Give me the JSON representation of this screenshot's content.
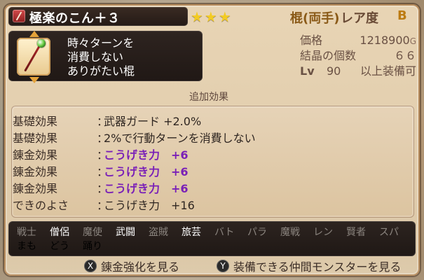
{
  "header": {
    "title": "極楽のこん＋３",
    "stars": "★★★",
    "weapon_type": "棍(両手)",
    "rarity_label": "レア度",
    "rarity_value": "B",
    "title_icon": "staff-item-icon"
  },
  "description": {
    "lines": [
      "時々ターンを",
      "消費しない",
      "ありがたい棍"
    ],
    "thumbnail_icon": "staff-thumbnail-icon"
  },
  "stats": {
    "price_label": "価格",
    "price_value": "1218900",
    "currency": "G",
    "crystal_label": "結晶の個数",
    "crystal_value": "６６",
    "lv_label": "Lv",
    "lv_value": "90",
    "lv_suffix": "以上装備可"
  },
  "effects_section": {
    "title": "追加効果",
    "rows": [
      {
        "label": "基礎効果",
        "value": "武器ガード +2.0%",
        "style": "normal"
      },
      {
        "label": "基礎効果",
        "value": "2%で行動ターンを消費しない",
        "style": "normal"
      },
      {
        "label": "錬金効果",
        "value": "こうげき力　+6",
        "style": "purple"
      },
      {
        "label": "錬金効果",
        "value": "こうげき力　+6",
        "style": "purple"
      },
      {
        "label": "錬金効果",
        "value": "こうげき力　+6",
        "style": "purple"
      },
      {
        "label": "できのよさ",
        "value": "こうげき力　+16",
        "style": "normal"
      }
    ]
  },
  "classes": {
    "top": [
      {
        "label": "戦士",
        "state": "dim"
      },
      {
        "label": "僧侶",
        "state": "on"
      },
      {
        "label": "魔使",
        "state": "dim"
      },
      {
        "label": "武闘",
        "state": "on"
      },
      {
        "label": "盗賊",
        "state": "dim"
      },
      {
        "label": "旅芸",
        "state": "on"
      },
      {
        "label": "バト",
        "state": "dim"
      },
      {
        "label": "パラ",
        "state": "dim"
      },
      {
        "label": "魔戦",
        "state": "dim"
      },
      {
        "label": "レン",
        "state": "dim"
      },
      {
        "label": "賢者",
        "state": "dim"
      },
      {
        "label": "スパ",
        "state": "dim"
      }
    ],
    "bottom": [
      {
        "label": "まも",
        "state": "dim"
      },
      {
        "label": "どう",
        "state": "dim"
      },
      {
        "label": "踊り",
        "state": "dim"
      }
    ]
  },
  "bottom": {
    "buttons": [
      {
        "icon": "X",
        "label": "錬金強化を見る"
      },
      {
        "icon": "Y",
        "label": "装備できる仲間モンスターを見る"
      }
    ]
  }
}
